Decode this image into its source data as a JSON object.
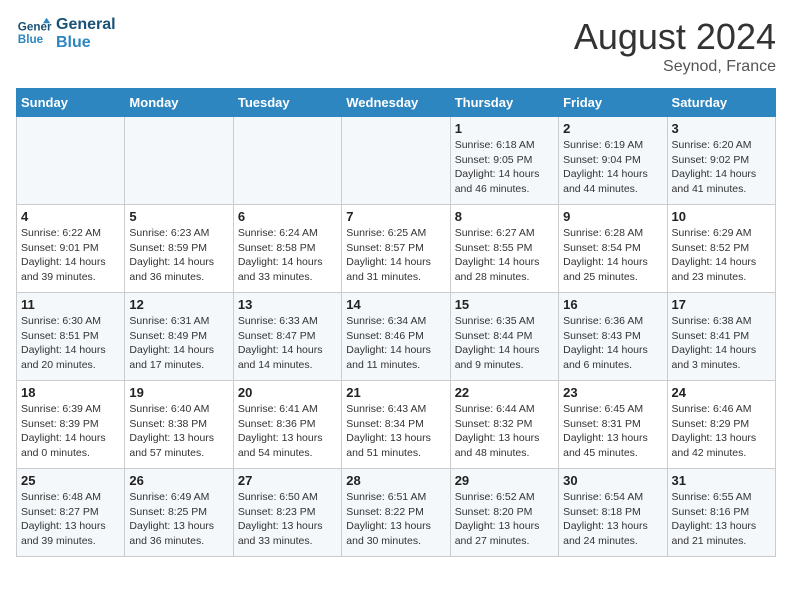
{
  "header": {
    "logo_line1": "General",
    "logo_line2": "Blue",
    "month": "August 2024",
    "location": "Seynod, France"
  },
  "weekdays": [
    "Sunday",
    "Monday",
    "Tuesday",
    "Wednesday",
    "Thursday",
    "Friday",
    "Saturday"
  ],
  "weeks": [
    [
      {
        "day": "",
        "info": ""
      },
      {
        "day": "",
        "info": ""
      },
      {
        "day": "",
        "info": ""
      },
      {
        "day": "",
        "info": ""
      },
      {
        "day": "1",
        "info": "Sunrise: 6:18 AM\nSunset: 9:05 PM\nDaylight: 14 hours and 46 minutes."
      },
      {
        "day": "2",
        "info": "Sunrise: 6:19 AM\nSunset: 9:04 PM\nDaylight: 14 hours and 44 minutes."
      },
      {
        "day": "3",
        "info": "Sunrise: 6:20 AM\nSunset: 9:02 PM\nDaylight: 14 hours and 41 minutes."
      }
    ],
    [
      {
        "day": "4",
        "info": "Sunrise: 6:22 AM\nSunset: 9:01 PM\nDaylight: 14 hours and 39 minutes."
      },
      {
        "day": "5",
        "info": "Sunrise: 6:23 AM\nSunset: 8:59 PM\nDaylight: 14 hours and 36 minutes."
      },
      {
        "day": "6",
        "info": "Sunrise: 6:24 AM\nSunset: 8:58 PM\nDaylight: 14 hours and 33 minutes."
      },
      {
        "day": "7",
        "info": "Sunrise: 6:25 AM\nSunset: 8:57 PM\nDaylight: 14 hours and 31 minutes."
      },
      {
        "day": "8",
        "info": "Sunrise: 6:27 AM\nSunset: 8:55 PM\nDaylight: 14 hours and 28 minutes."
      },
      {
        "day": "9",
        "info": "Sunrise: 6:28 AM\nSunset: 8:54 PM\nDaylight: 14 hours and 25 minutes."
      },
      {
        "day": "10",
        "info": "Sunrise: 6:29 AM\nSunset: 8:52 PM\nDaylight: 14 hours and 23 minutes."
      }
    ],
    [
      {
        "day": "11",
        "info": "Sunrise: 6:30 AM\nSunset: 8:51 PM\nDaylight: 14 hours and 20 minutes."
      },
      {
        "day": "12",
        "info": "Sunrise: 6:31 AM\nSunset: 8:49 PM\nDaylight: 14 hours and 17 minutes."
      },
      {
        "day": "13",
        "info": "Sunrise: 6:33 AM\nSunset: 8:47 PM\nDaylight: 14 hours and 14 minutes."
      },
      {
        "day": "14",
        "info": "Sunrise: 6:34 AM\nSunset: 8:46 PM\nDaylight: 14 hours and 11 minutes."
      },
      {
        "day": "15",
        "info": "Sunrise: 6:35 AM\nSunset: 8:44 PM\nDaylight: 14 hours and 9 minutes."
      },
      {
        "day": "16",
        "info": "Sunrise: 6:36 AM\nSunset: 8:43 PM\nDaylight: 14 hours and 6 minutes."
      },
      {
        "day": "17",
        "info": "Sunrise: 6:38 AM\nSunset: 8:41 PM\nDaylight: 14 hours and 3 minutes."
      }
    ],
    [
      {
        "day": "18",
        "info": "Sunrise: 6:39 AM\nSunset: 8:39 PM\nDaylight: 14 hours and 0 minutes."
      },
      {
        "day": "19",
        "info": "Sunrise: 6:40 AM\nSunset: 8:38 PM\nDaylight: 13 hours and 57 minutes."
      },
      {
        "day": "20",
        "info": "Sunrise: 6:41 AM\nSunset: 8:36 PM\nDaylight: 13 hours and 54 minutes."
      },
      {
        "day": "21",
        "info": "Sunrise: 6:43 AM\nSunset: 8:34 PM\nDaylight: 13 hours and 51 minutes."
      },
      {
        "day": "22",
        "info": "Sunrise: 6:44 AM\nSunset: 8:32 PM\nDaylight: 13 hours and 48 minutes."
      },
      {
        "day": "23",
        "info": "Sunrise: 6:45 AM\nSunset: 8:31 PM\nDaylight: 13 hours and 45 minutes."
      },
      {
        "day": "24",
        "info": "Sunrise: 6:46 AM\nSunset: 8:29 PM\nDaylight: 13 hours and 42 minutes."
      }
    ],
    [
      {
        "day": "25",
        "info": "Sunrise: 6:48 AM\nSunset: 8:27 PM\nDaylight: 13 hours and 39 minutes."
      },
      {
        "day": "26",
        "info": "Sunrise: 6:49 AM\nSunset: 8:25 PM\nDaylight: 13 hours and 36 minutes."
      },
      {
        "day": "27",
        "info": "Sunrise: 6:50 AM\nSunset: 8:23 PM\nDaylight: 13 hours and 33 minutes."
      },
      {
        "day": "28",
        "info": "Sunrise: 6:51 AM\nSunset: 8:22 PM\nDaylight: 13 hours and 30 minutes."
      },
      {
        "day": "29",
        "info": "Sunrise: 6:52 AM\nSunset: 8:20 PM\nDaylight: 13 hours and 27 minutes."
      },
      {
        "day": "30",
        "info": "Sunrise: 6:54 AM\nSunset: 8:18 PM\nDaylight: 13 hours and 24 minutes."
      },
      {
        "day": "31",
        "info": "Sunrise: 6:55 AM\nSunset: 8:16 PM\nDaylight: 13 hours and 21 minutes."
      }
    ]
  ]
}
